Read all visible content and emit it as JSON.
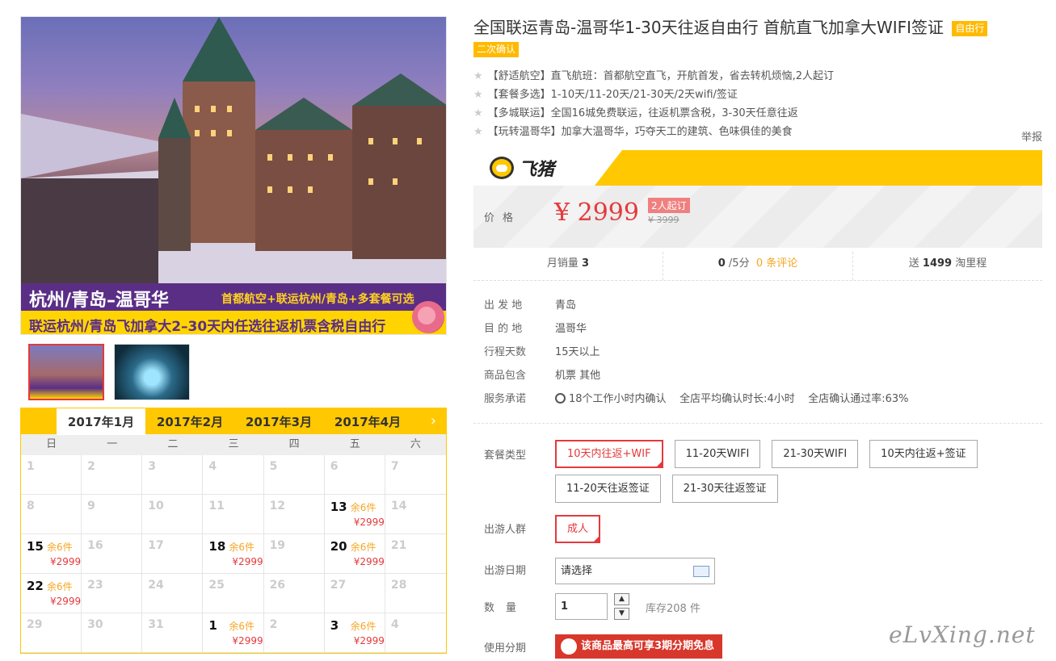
{
  "product": {
    "title": "全国联运青岛-温哥华1-30天往返自由行 首航直飞加拿大WIFI签证",
    "tag": "自由行",
    "tag2": "二次确认",
    "features": [
      "【舒适航空】直飞航班：首都航空直飞，开航首发，省去转机烦恼,2人起订",
      "【套餐多选】1-10天/11-20天/21-30天/2天wifi/签证",
      "【多城联运】全国16城免费联运，往返机票含税，3-30天任意往返",
      "【玩转温哥华】加拿大温哥华，巧夺天工的建筑、色味俱佳的美食"
    ],
    "report": "举报"
  },
  "image": {
    "banner_title": "杭州/青岛–温哥华",
    "banner_sub": "首都航空+联运杭州/青岛+多套餐可选",
    "banner_bottom": "联运杭州/青岛飞加拿大2–30天内任选往返机票含税自由行"
  },
  "brand": {
    "name": "飞猪"
  },
  "price": {
    "label": "价格",
    "value": "¥ 2999",
    "min_tag": "2人起订",
    "original": "¥ 3999"
  },
  "stats": {
    "sales_label": "月销量",
    "sales": "3",
    "rating": "0",
    "rating_suffix": "/5分",
    "comments": "0 条评论",
    "points_pre": "送",
    "points": "1499",
    "points_suffix": "淘里程"
  },
  "info": [
    {
      "label": "出 发 地",
      "value": "青岛"
    },
    {
      "label": "目 的 地",
      "value": "温哥华"
    },
    {
      "label": "行程天数",
      "value": "15天以上"
    },
    {
      "label": "商品包含",
      "value": "机票  其他"
    },
    {
      "label": "服务承诺",
      "value": "18个工作小时内确认    全店平均确认时长:4小时    全店确认通过率:63%"
    }
  ],
  "options": {
    "package_label": "套餐类型",
    "packages": [
      "10天内往返+WIF",
      "11-20天WIFI",
      "21-30天WIFI",
      "10天内往返+签证",
      "11-20天往返签证",
      "21-30天往返签证"
    ],
    "group_label": "出游人群",
    "group": "成人",
    "date_label": "出游日期",
    "date_placeholder": "请选择",
    "qty_label": "数量",
    "qty": "1",
    "stock": "库存208 件",
    "installment_label": "使用分期",
    "installment": "该商品最高可享3期分期免息"
  },
  "calendar": {
    "months": [
      "2017年1月",
      "2017年2月",
      "2017年3月",
      "2017年4月"
    ],
    "weekdays": [
      "日",
      "一",
      "二",
      "三",
      "四",
      "五",
      "六"
    ],
    "cells": [
      {
        "d": "1"
      },
      {
        "d": "2"
      },
      {
        "d": "3"
      },
      {
        "d": "4"
      },
      {
        "d": "5"
      },
      {
        "d": "6"
      },
      {
        "d": "7"
      },
      {
        "d": "8"
      },
      {
        "d": "9"
      },
      {
        "d": "10"
      },
      {
        "d": "11"
      },
      {
        "d": "12"
      },
      {
        "d": "13",
        "s": "余6件",
        "p": "¥2999"
      },
      {
        "d": "14"
      },
      {
        "d": "15",
        "s": "余6件",
        "p": "¥2999"
      },
      {
        "d": "16"
      },
      {
        "d": "17"
      },
      {
        "d": "18",
        "s": "余6件",
        "p": "¥2999"
      },
      {
        "d": "19"
      },
      {
        "d": "20",
        "s": "余6件",
        "p": "¥2999"
      },
      {
        "d": "21"
      },
      {
        "d": "22",
        "s": "余6件",
        "p": "¥2999"
      },
      {
        "d": "23"
      },
      {
        "d": "24"
      },
      {
        "d": "25"
      },
      {
        "d": "26"
      },
      {
        "d": "27"
      },
      {
        "d": "28"
      },
      {
        "d": "29"
      },
      {
        "d": "30"
      },
      {
        "d": "31"
      },
      {
        "d": "1",
        "s": "余6件",
        "p": "¥2999"
      },
      {
        "d": "2"
      },
      {
        "d": "3",
        "s": "余6件",
        "p": "¥2999"
      },
      {
        "d": "4"
      }
    ]
  },
  "watermark": "eLvXing.net",
  "colors": {
    "accent": "#e4393c",
    "brand_yellow": "#ffc800",
    "stock_orange": "#f5a623"
  }
}
